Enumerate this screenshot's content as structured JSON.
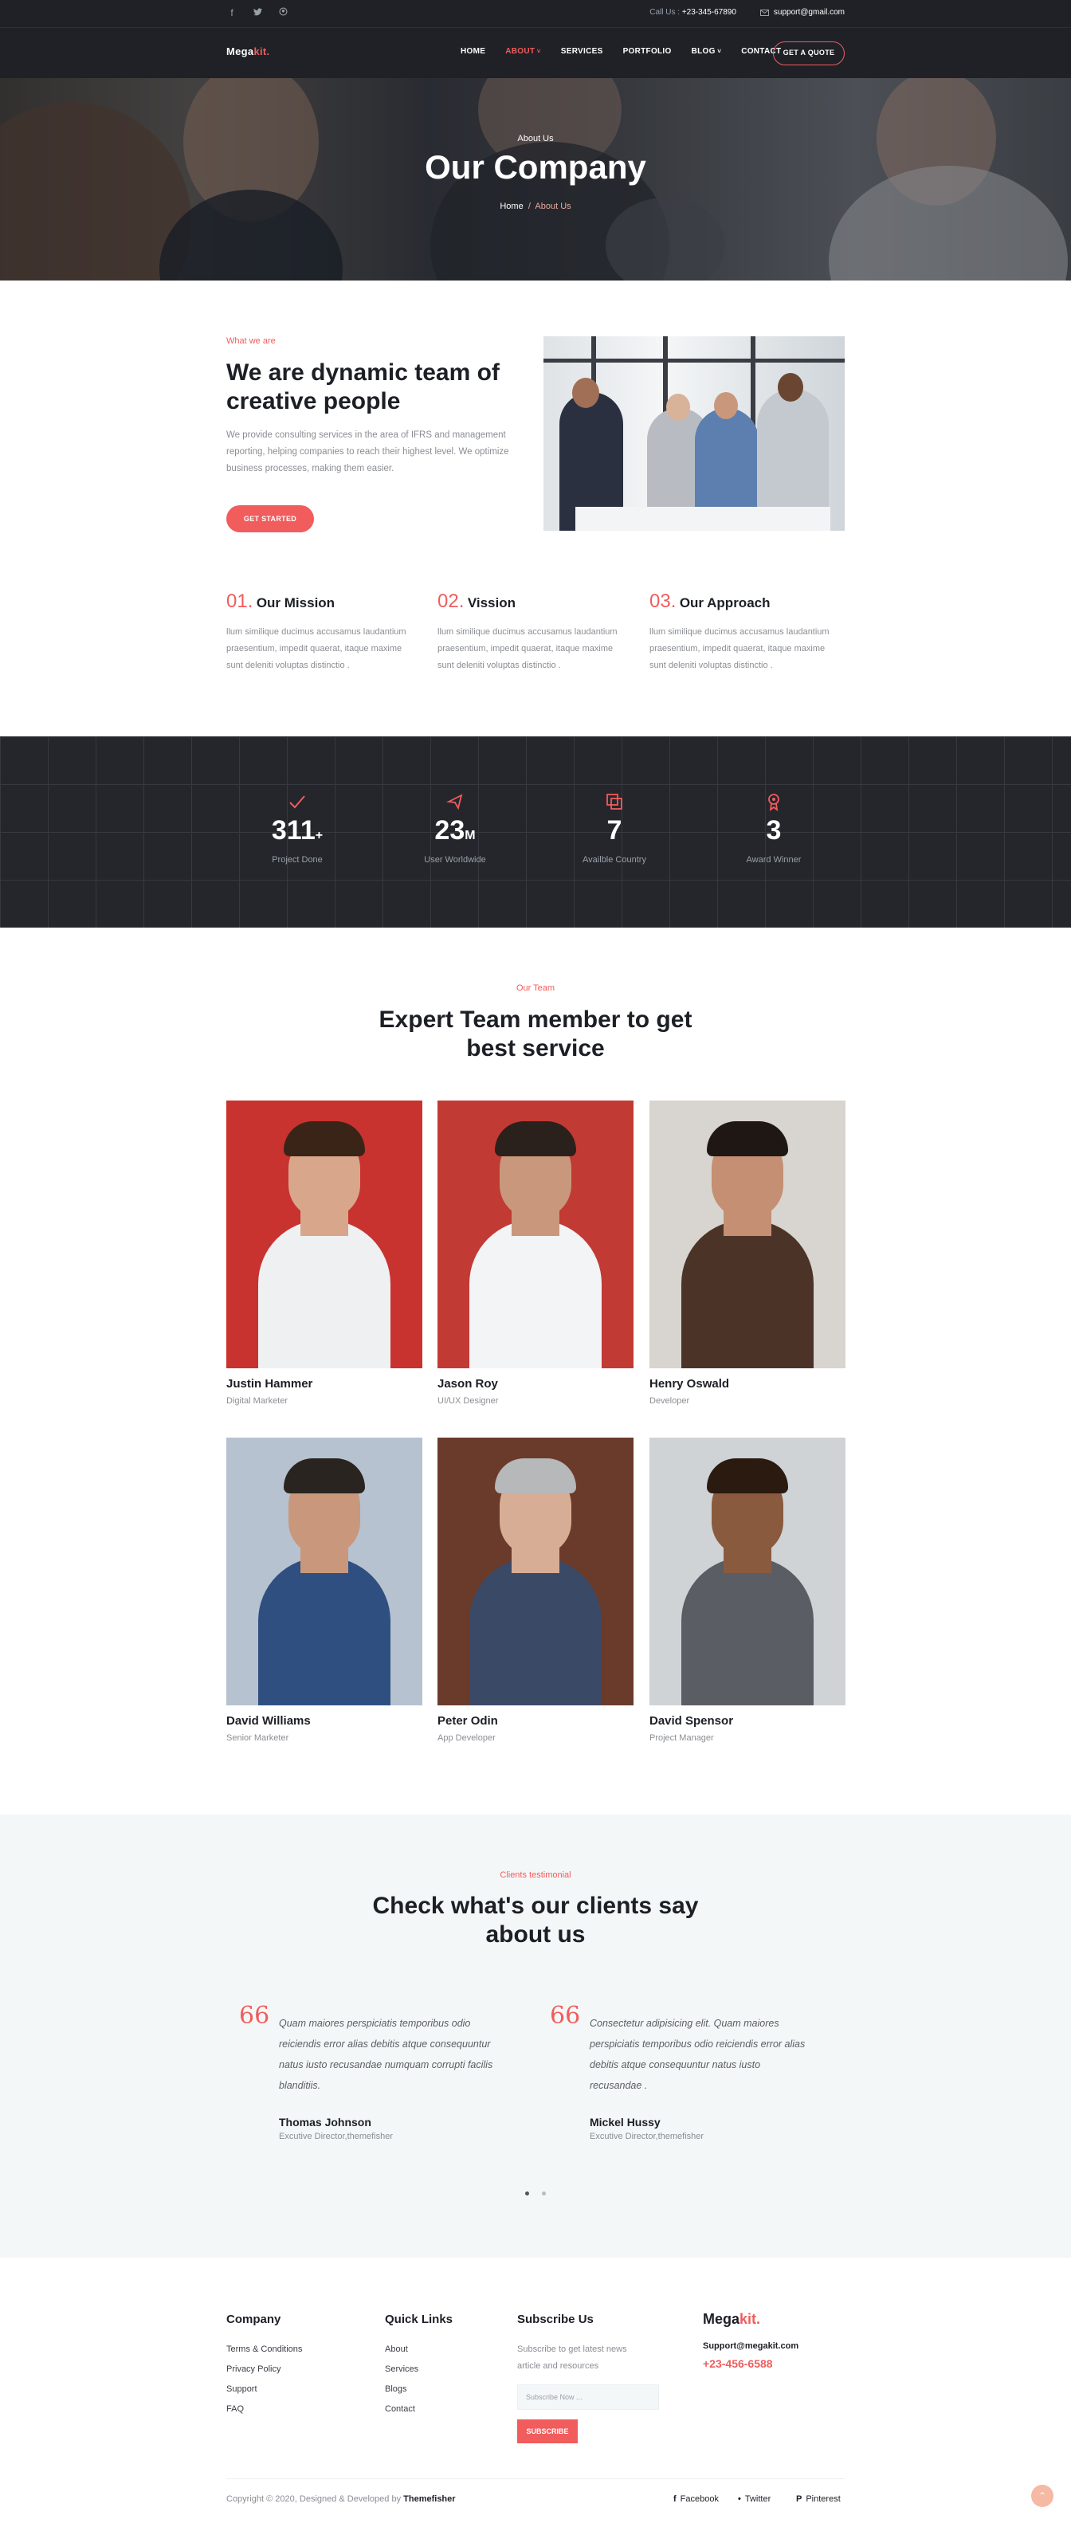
{
  "topbar": {
    "social_icons": [
      "facebook-icon",
      "twitter-icon",
      "github-icon"
    ],
    "call_label": "Call Us :",
    "phone": "+23-345-67890",
    "email": "support@gmail.com"
  },
  "nav": {
    "logo_main": "Mega",
    "logo_accent": "kit.",
    "items": [
      {
        "label": "HOME",
        "active": false,
        "dropdown": false
      },
      {
        "label": "ABOUT",
        "active": true,
        "dropdown": true
      },
      {
        "label": "SERVICES",
        "active": false,
        "dropdown": false
      },
      {
        "label": "PORTFOLIO",
        "active": false,
        "dropdown": false
      },
      {
        "label": "BLOG",
        "active": false,
        "dropdown": true
      },
      {
        "label": "CONTACT",
        "active": false,
        "dropdown": false
      }
    ],
    "cta": "GET A QUOTE"
  },
  "hero": {
    "subtitle": "About Us",
    "title": "Our Company",
    "breadcrumb_home": "Home",
    "breadcrumb_sep": "/",
    "breadcrumb_current": "About Us"
  },
  "about": {
    "eyebrow": "What we are",
    "heading_line1": "We are dynamic team of",
    "heading_line2": "creative people",
    "body_lines": [
      "We provide consulting services in the area of IFRS and management",
      "reporting, helping companies to reach their highest level. We optimize",
      "business processes, making them easier."
    ],
    "button": "GET STARTED"
  },
  "missions": [
    {
      "num": "01.",
      "title": "Our Mission",
      "lines": [
        "llum similique ducimus accusamus laudantium",
        "praesentium, impedit quaerat, itaque maxime",
        "sunt deleniti voluptas distinctio ."
      ]
    },
    {
      "num": "02.",
      "title": "Vission",
      "lines": [
        "llum similique ducimus accusamus laudantium",
        "praesentium, impedit quaerat, itaque maxime",
        "sunt deleniti voluptas distinctio ."
      ]
    },
    {
      "num": "03.",
      "title": "Our Approach",
      "lines": [
        "llum similique ducimus accusamus laudantium",
        "praesentium, impedit quaerat, itaque maxime",
        "sunt deleniti voluptas distinctio ."
      ]
    }
  ],
  "stats": [
    {
      "icon": "check-icon",
      "value": "311",
      "suffix": "+",
      "label": "Project Done"
    },
    {
      "icon": "flag-icon",
      "value": "23",
      "suffix": "M",
      "label": "User Worldwide"
    },
    {
      "icon": "layers-icon",
      "value": "7",
      "suffix": "",
      "label": "Availble Country"
    },
    {
      "icon": "award-icon",
      "value": "3",
      "suffix": "",
      "label": "Award Winner"
    }
  ],
  "team": {
    "eyebrow": "Our Team",
    "heading_line1": "Expert Team member to get",
    "heading_line2": "best service",
    "members": [
      {
        "name": "Justin Hammer",
        "role": "Digital Marketer",
        "bg": "#c8322f",
        "shirt": "#eef0f2",
        "skin": "#d8a78b",
        "hair": "#3a2418"
      },
      {
        "name": "Jason Roy",
        "role": "UI/UX Designer",
        "bg": "#c23a34",
        "shirt": "#f2f4f6",
        "skin": "#c9987c",
        "hair": "#2b211c"
      },
      {
        "name": "Henry Oswald",
        "role": "Developer",
        "bg": "#d8d4cf",
        "shirt": "#4b3427",
        "skin": "#c48f72",
        "hair": "#1e1713"
      },
      {
        "name": "David Williams",
        "role": "Senior Marketer",
        "bg": "#b6c2cf",
        "shirt": "#2f4f80",
        "skin": "#c9987c",
        "hair": "#2a2420"
      },
      {
        "name": "Peter Odin",
        "role": "App Developer",
        "bg": "#6a3a2a",
        "shirt": "#3a4a66",
        "skin": "#d8ad95",
        "hair": "#b6b8ba"
      },
      {
        "name": "David Spensor",
        "role": "Project Manager",
        "bg": "#cfd3d6",
        "shirt": "#5a5d63",
        "skin": "#8a5a3e",
        "hair": "#2a1a10"
      }
    ]
  },
  "testimonials": {
    "eyebrow": "Clients testimonial",
    "heading_line1": "Check what's our clients say",
    "heading_line2": "about us",
    "quote_mark": "66",
    "items": [
      {
        "lines": [
          "Quam maiores perspiciatis temporibus odio",
          "reiciendis error alias debitis atque consequuntur",
          "natus iusto recusandae numquam corrupti facilis",
          "blanditiis."
        ],
        "name": "Thomas Johnson",
        "role": "Excutive Director,themefisher"
      },
      {
        "lines": [
          "Consectetur adipisicing elit. Quam maiores",
          "perspiciatis temporibus odio reiciendis error alias",
          "debitis atque consequuntur natus iusto",
          "recusandae ."
        ],
        "name": "Mickel Hussy",
        "role": "Excutive Director,themefisher"
      }
    ]
  },
  "footer": {
    "company_head": "Company",
    "company_links": [
      "Terms & Conditions",
      "Privacy Policy",
      "Support",
      "FAQ"
    ],
    "quick_head": "Quick Links",
    "quick_links": [
      "About",
      "Services",
      "Blogs",
      "Contact"
    ],
    "subscribe_head": "Subscribe Us",
    "subscribe_text_1": "Subscribe to get latest news",
    "subscribe_text_2": "article and resources",
    "subscribe_placeholder": "Subscribe Now ...",
    "subscribe_button": "SUBSCRIBE",
    "logo_main": "Mega",
    "logo_accent": "kit.",
    "email": "Support@megakit.com",
    "phone": "+23-456-6588",
    "copyright_prefix": "Copyright © 2020, Designed & Developed by",
    "copyright_brand": "Themefisher",
    "social": [
      "Facebook",
      "Twitter",
      "Pinterest"
    ]
  },
  "colors": {
    "accent": "#f15c5c",
    "dark": "#1f2127",
    "light_bg": "#f4f7f7"
  }
}
